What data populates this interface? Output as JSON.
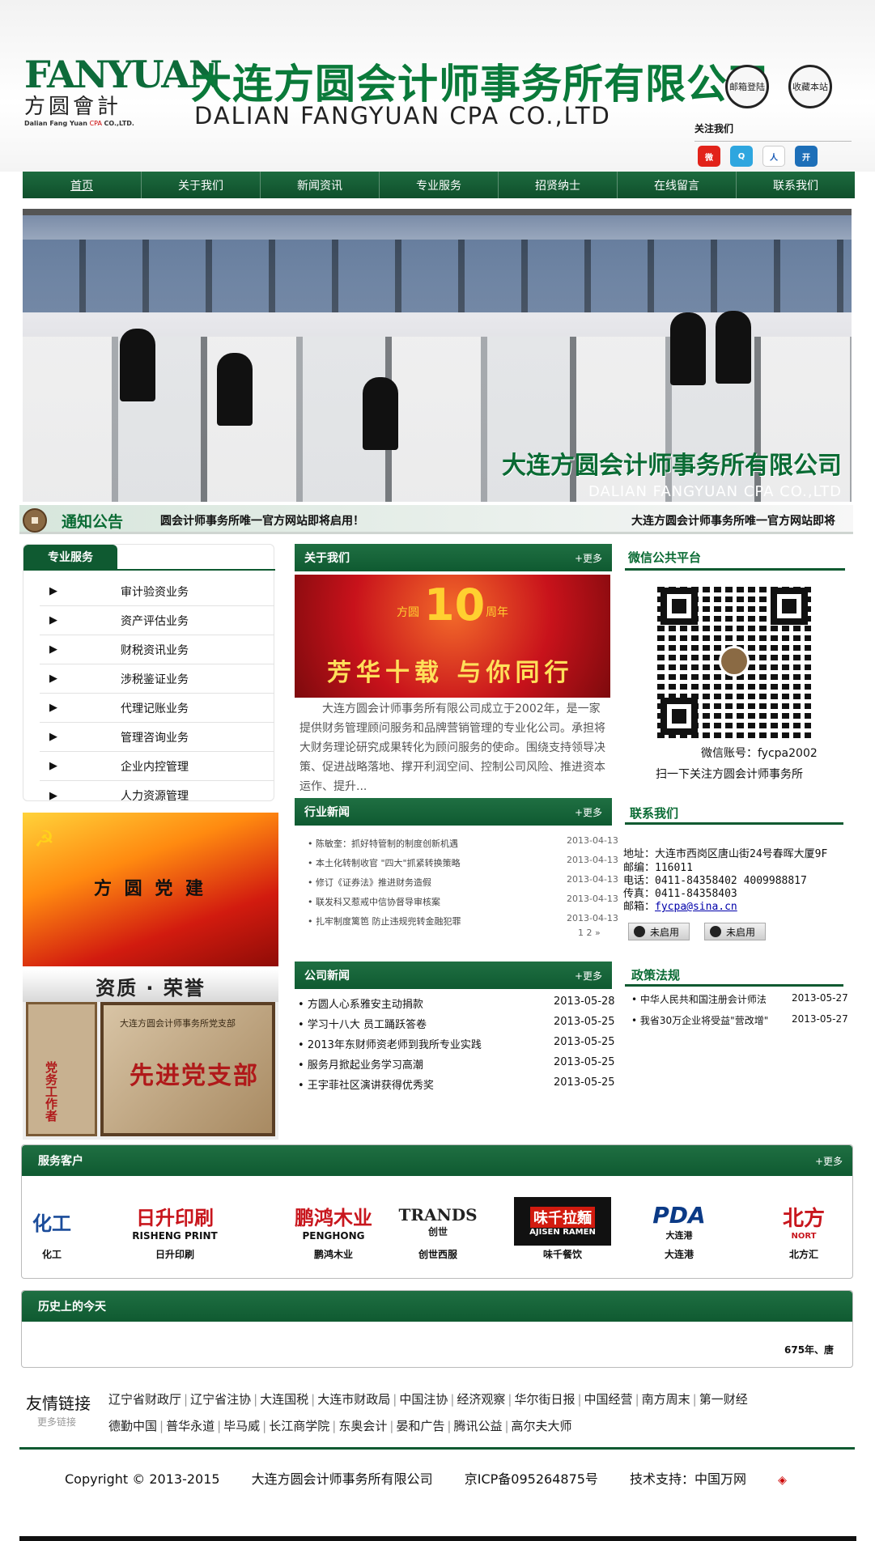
{
  "header": {
    "logo_en": "FANYUAN",
    "logo_cn": "方圆會計",
    "logo_sub": "Dalian Fang Yuan",
    "logo_sub_cpa": "CPA",
    "logo_sub_end": "CO.,LTD.",
    "title_cn": "大连方圆会计师事务所有限公司",
    "title_en": "DALIAN FANGYUAN CPA CO.,LTD",
    "mail_login": "邮箱登陆",
    "bookmark": "收藏本站",
    "follow_us": "关注我们",
    "social_icons": [
      "weibo-icon",
      "qq-weibo-icon",
      "renren-icon",
      "kaixin-icon"
    ]
  },
  "nav": {
    "items": [
      "首页",
      "关于我们",
      "新闻资讯",
      "专业服务",
      "招贤纳士",
      "在线留言",
      "联系我们"
    ]
  },
  "banner": {
    "caption_cn": "大连方圆会计师事务所有限公司",
    "caption_en": "DALIAN FANGYUAN CPA CO.,LTD"
  },
  "notice": {
    "title": "通知公告",
    "text_a": "圆会计师事务所唯一官方网站即将启用！",
    "text_b": "大连方圆会计师事务所唯一官方网站即将"
  },
  "services": {
    "title": "专业服务",
    "items": [
      "审计验资业务",
      "资产评估业务",
      "财税资讯业务",
      "涉税鉴证业务",
      "代理记账业务",
      "管理咨询业务",
      "企业内控管理",
      "人力资源管理"
    ]
  },
  "party": {
    "label": "方 圆 党 建"
  },
  "honor": {
    "title": "资质 · 荣誉",
    "plaque1": "党务工作者",
    "plaque2_top": "大连方圆会计师事务所党支部",
    "plaque2_big": "先进党支部"
  },
  "about": {
    "title": "关于我们",
    "more": "+更多",
    "image_sub1": "方圆",
    "image_ten": "10",
    "image_sub2": "周年",
    "image_slogan": "芳华十载  与你同行",
    "text": "大连方圆会计师事务所有限公司成立于2002年，是一家提供财务管理顾问服务和品牌营销管理的专业化公司。承担将大财务理论研究成果转化为顾问服务的使命。围绕支持领导决策、促进战略落地、撑开利润空间、控制公司风险、推进资本运作、提升..."
  },
  "industry_news": {
    "title": "行业新闻",
    "more": "+更多",
    "items": [
      {
        "title": "陈敏奎：抓好特管制的制度创新机遇",
        "date": "2013-04-13"
      },
      {
        "title": "本土化转制收官 \"四大\"抓紧转换策略",
        "date": "2013-04-13"
      },
      {
        "title": "修订《证券法》推进财务造假",
        "date": "2013-04-13"
      },
      {
        "title": "联发科又惹戒中信协督导审核案",
        "date": "2013-04-13"
      },
      {
        "title": "扎牢制度篱笆 防止违规兜转金融犯罪",
        "date": "2013-04-13"
      }
    ],
    "pager": "1  2  »"
  },
  "company_news": {
    "title": "公司新闻",
    "more": "+更多",
    "items": [
      {
        "title": "方圆人心系雅安主动捐款",
        "date": "2013-05-28"
      },
      {
        "title": "学习十八大 员工踊跃答卷",
        "date": "2013-05-25"
      },
      {
        "title": "2013年东财师资老师到我所专业实践",
        "date": "2013-05-25"
      },
      {
        "title": "服务月掀起业务学习高潮",
        "date": "2013-05-25"
      },
      {
        "title": "王宇菲社区演讲获得优秀奖",
        "date": "2013-05-25"
      }
    ]
  },
  "wechat": {
    "title": "微信公共平台",
    "account": "微信账号：fycpa2002",
    "scan_tip": "扫一下关注方圆会计师事务所"
  },
  "contact": {
    "title": "联系我们",
    "address": "地址：大连市西岗区唐山街24号春晖大厦9F",
    "zip": "邮编：116011",
    "phone": "电话：0411-84358402  4009988817",
    "fax": "传真：0411-84358403",
    "email_label": "邮箱：",
    "email": "fycpa@sina.cn",
    "qq1": "未启用",
    "qq2": "未启用"
  },
  "policy": {
    "title": "政策法规",
    "items": [
      {
        "title": "中华人民共和国注册会计师法",
        "date": "2013-05-27"
      },
      {
        "title": "我省30万企业将受益\"营改增\"",
        "date": "2013-05-27"
      }
    ]
  },
  "clients": {
    "title": "服务客户",
    "more": "+更多",
    "items": [
      {
        "name": "化工",
        "logo": "化工"
      },
      {
        "name": "日升印刷",
        "logo": "日升印刷"
      },
      {
        "name": "鹏鸿木业",
        "logo": "鹏鸿木业"
      },
      {
        "name": "创世西服",
        "logo": "TRANDS"
      },
      {
        "name": "味千餐饮",
        "logo": "味千拉麵"
      },
      {
        "name": "大连港",
        "logo": "PDA"
      },
      {
        "name": "北方汇",
        "logo": "北方"
      }
    ],
    "logo_sub": [
      "",
      "RISHENG PRINT",
      "PENGHONG",
      "创世",
      "AJISEN RAMEN",
      "大连港",
      "NORT"
    ]
  },
  "history": {
    "title": "历史上的今天",
    "text": "675年、唐"
  },
  "friend_links": {
    "title": "友情链接",
    "subtitle": "更多链接",
    "row1": [
      "辽宁省财政厅",
      "辽宁省注协",
      "大连国税",
      "大连市财政局",
      "中国注协",
      "经济观察",
      "华尔街日报",
      "中国经营",
      "南方周末",
      "第一财经"
    ],
    "row2": [
      "德勤中国",
      "普华永道",
      "毕马威",
      "长江商学院",
      "东奥会计",
      "晏和广告",
      "腾讯公益",
      "高尔夫大师"
    ]
  },
  "footer": {
    "copyright": "Copyright © 2013-2015",
    "company": "大连方圆会计师事务所有限公司",
    "icp": "京ICP备095264875号",
    "support": "技术支持：中国万网"
  }
}
